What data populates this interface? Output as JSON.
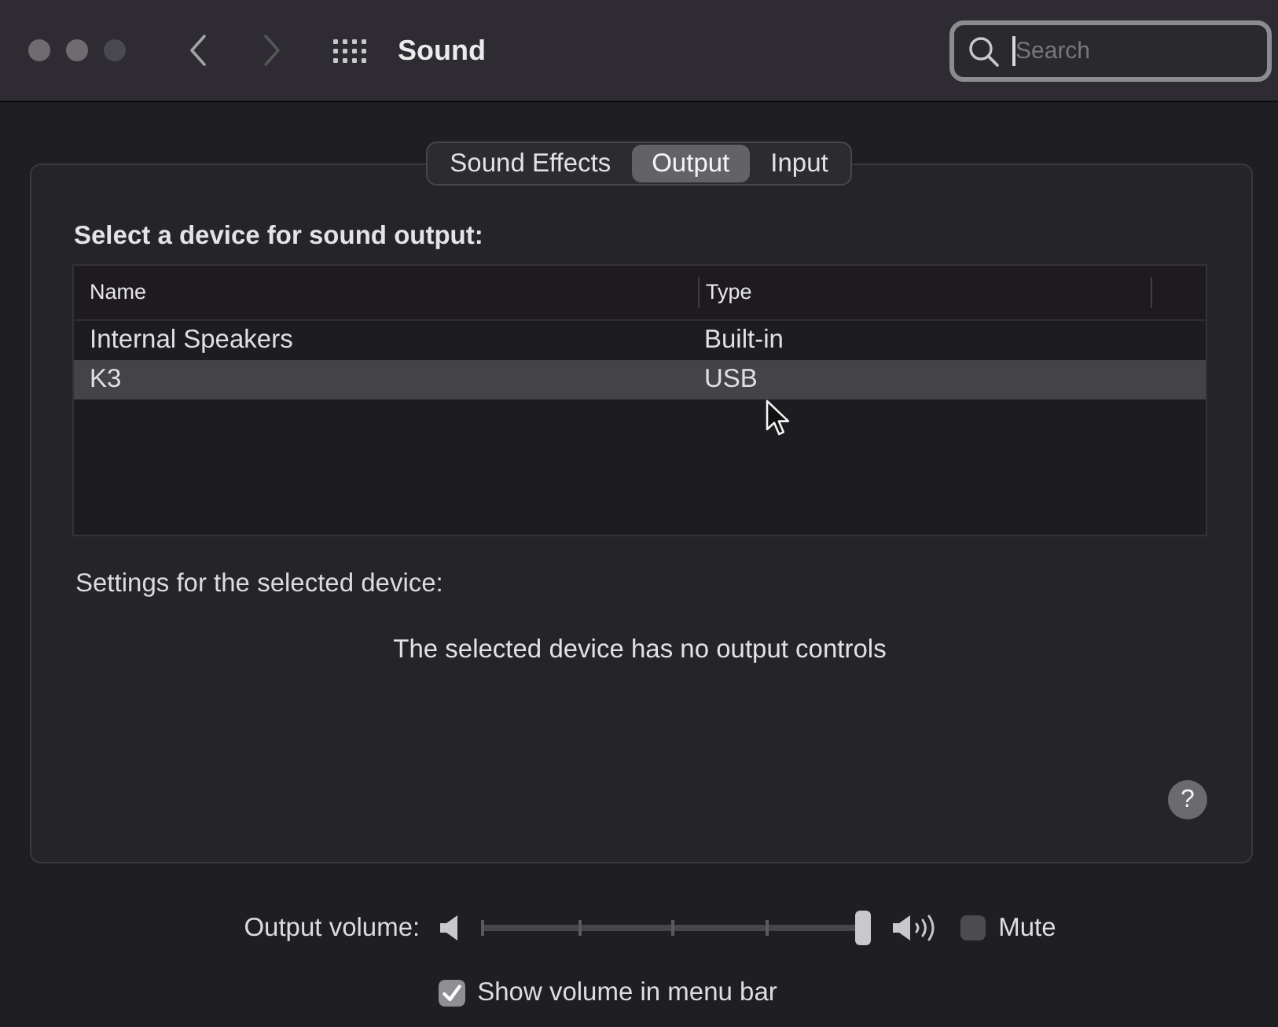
{
  "window": {
    "title": "Sound",
    "controls": [
      {
        "disabled": false
      },
      {
        "disabled": false
      },
      {
        "disabled": true
      }
    ]
  },
  "navigation": [
    {
      "kind": "back",
      "disabled": false
    },
    {
      "kind": "forward",
      "disabled": true
    }
  ],
  "search": {
    "placeholder": "Search",
    "focused": true
  },
  "tabs": [
    {
      "label": "Sound Effects",
      "selected": false
    },
    {
      "label": "Output",
      "selected": true
    },
    {
      "label": "Input",
      "selected": false
    }
  ],
  "device_section": {
    "heading": "Select a device for sound output:",
    "table": {
      "columns": [
        "Name",
        "Type"
      ],
      "rows": [
        {
          "cells": [
            "Internal Speakers",
            "Built-in"
          ],
          "selected": false
        },
        {
          "cells": [
            "K3",
            "USB"
          ],
          "selected": true
        }
      ]
    }
  },
  "settings": {
    "heading": "Settings for the selected device:",
    "message": "The selected device has no output controls",
    "help_button": {
      "label": "?"
    }
  },
  "volume": {
    "label": "Output volume:",
    "level": 1
  },
  "mute": {
    "label": "Mute",
    "checked": false
  },
  "show_in_menu_bar": {
    "label": "Show volume in menu bar",
    "checked": true
  }
}
